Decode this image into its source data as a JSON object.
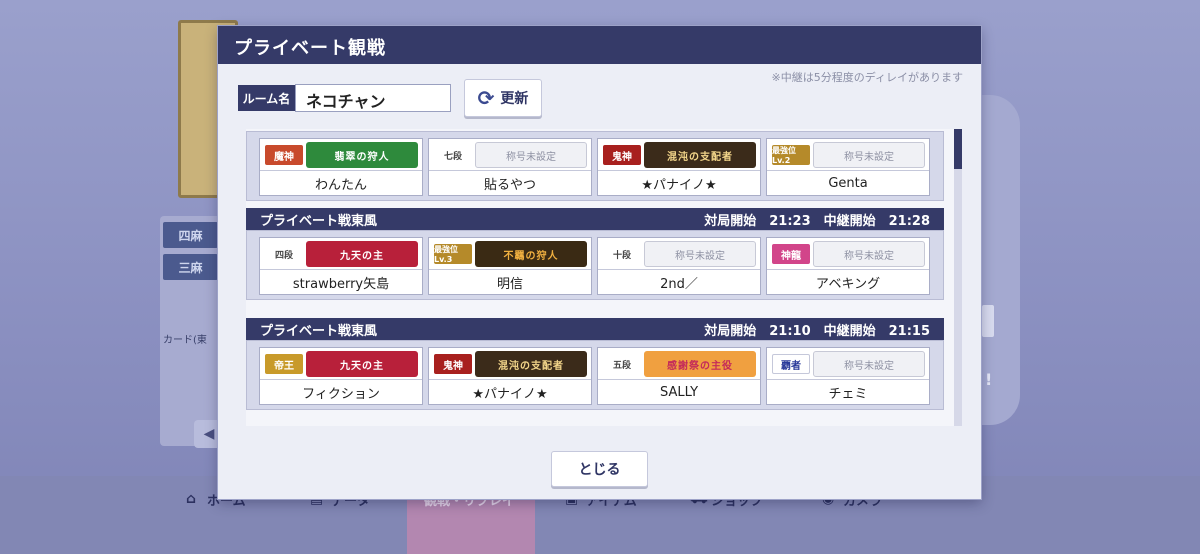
{
  "modal": {
    "title": "プライベート観戦",
    "note": "※中継は5分程度のディレイがあります",
    "room_label": "ルーム名",
    "room_name": "ネコチャン",
    "refresh_label": "更新",
    "close_label": "とじる"
  },
  "matches": [
    {
      "mode": "",
      "info": "",
      "players": [
        {
          "name": "わんたん",
          "rank": "魔神",
          "title": "翡翠の狩人",
          "title_color": "#2e8a3c"
        },
        {
          "name": "貼るやつ",
          "rank": "七段",
          "title": "称号未設定",
          "title_color": ""
        },
        {
          "name": "★パナイノ★",
          "rank": "鬼神",
          "title": "混沌の支配者",
          "title_color": "#3b2b1a"
        },
        {
          "name": "Genta",
          "rank": "最強位Lv.2",
          "title": "称号未設定",
          "title_color": ""
        }
      ]
    },
    {
      "mode": "プライベート戦東風",
      "info": "対局開始　21:23　中継開始　21:28",
      "players": [
        {
          "name": "strawberry矢島",
          "rank": "四段",
          "title": "九天の主",
          "title_color": "#b8203a"
        },
        {
          "name": "明信",
          "rank": "最強位Lv.3",
          "title": "不羈の狩人",
          "title_color": "#3a2a14"
        },
        {
          "name": "2nd／",
          "rank": "十段",
          "title": "称号未設定",
          "title_color": ""
        },
        {
          "name": "アベキング",
          "rank": "神龍",
          "title": "称号未設定",
          "title_color": ""
        }
      ]
    },
    {
      "mode": "プライベート戦東風",
      "info": "対局開始　21:10　中継開始　21:15",
      "players": [
        {
          "name": "フィクション",
          "rank": "帝王",
          "title": "九天の主",
          "title_color": "#b8203a"
        },
        {
          "name": "★パナイノ★",
          "rank": "鬼神",
          "title": "混沌の支配者",
          "title_color": "#3b2b1a"
        },
        {
          "name": "SALLY",
          "rank": "五段",
          "title": "感謝祭の主役",
          "title_color": "#f0a040"
        },
        {
          "name": "チェミ",
          "rank": "覇者",
          "title": "称号未設定",
          "title_color": ""
        }
      ]
    }
  ],
  "background": {
    "modes": [
      "四麻",
      "三麻"
    ],
    "card_label": "カード(東",
    "nav": [
      "ホーム",
      "データ",
      "観戦・リプレイ",
      "アイテム",
      "ショップ",
      "カメラ"
    ]
  }
}
